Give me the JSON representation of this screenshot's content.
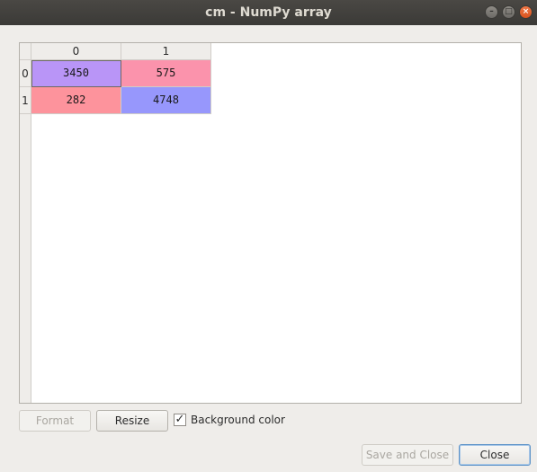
{
  "window": {
    "title": "cm - NumPy array",
    "controls": {
      "minimize_glyph": "–",
      "maximize_glyph": "□",
      "close_glyph": "×"
    }
  },
  "table": {
    "column_headers": [
      "0",
      "1"
    ],
    "row_headers": [
      "0",
      "1"
    ],
    "cells": [
      [
        {
          "value": "3450",
          "bg": "#b995f7"
        },
        {
          "value": "575",
          "bg": "#fb93ac"
        }
      ],
      [
        {
          "value": "282",
          "bg": "#fd939c"
        },
        {
          "value": "4748",
          "bg": "#9797fc"
        }
      ]
    ],
    "selected_cell": "0,0"
  },
  "controls": {
    "format_label": "Format",
    "format_enabled": false,
    "resize_label": "Resize",
    "background_color_label": "Background color",
    "background_color_checked": true,
    "checkbox_glyph": "✓",
    "save_and_close_label": "Save and Close",
    "save_and_close_enabled": false,
    "close_label": "Close"
  }
}
